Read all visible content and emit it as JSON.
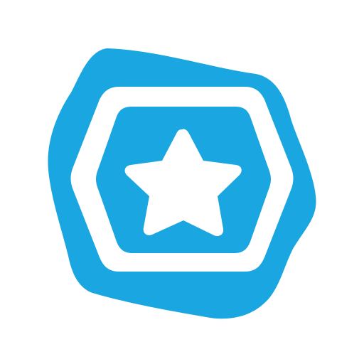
{
  "icon": {
    "name": "star-badge-app-icon",
    "symbol": "star-icon",
    "colors": {
      "background": "#ffffff",
      "badge_fill": "#1aa7e1",
      "ring_fill": "#ffffff",
      "star_fill": "#ffffff"
    }
  }
}
